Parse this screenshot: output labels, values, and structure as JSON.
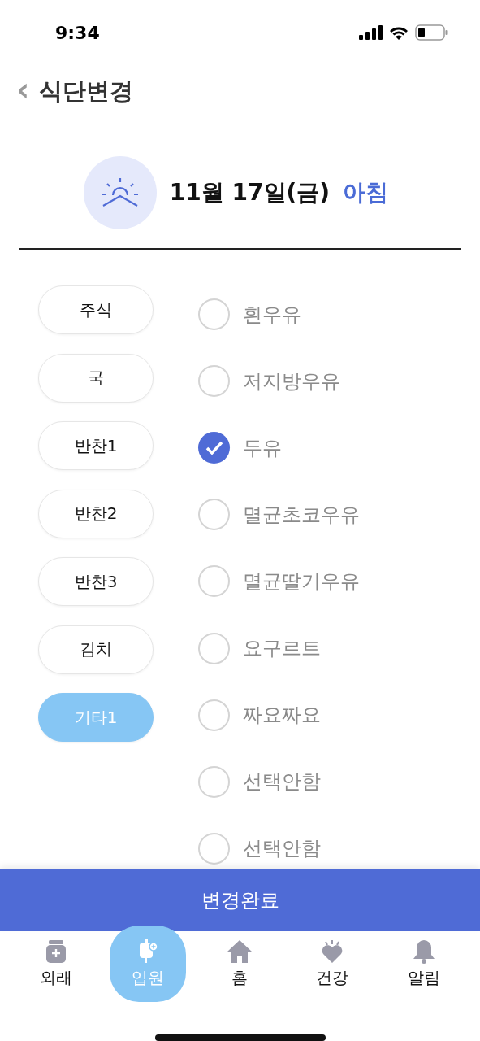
{
  "status_bar": {
    "time": "9:34"
  },
  "header": {
    "back": "‹",
    "title": "식단변경"
  },
  "meal": {
    "date": "11월 17일(금)",
    "period": "아침"
  },
  "categories": [
    {
      "label": "주식",
      "selected": false
    },
    {
      "label": "국",
      "selected": false
    },
    {
      "label": "반찬1",
      "selected": false
    },
    {
      "label": "반찬2",
      "selected": false
    },
    {
      "label": "반찬3",
      "selected": false
    },
    {
      "label": "김치",
      "selected": false
    },
    {
      "label": "기타1",
      "selected": true
    }
  ],
  "options": [
    {
      "label": "흰우유",
      "selected": false
    },
    {
      "label": "저지방우유",
      "selected": false
    },
    {
      "label": "두유",
      "selected": true
    },
    {
      "label": "멸균초코우유",
      "selected": false
    },
    {
      "label": "멸균딸기우유",
      "selected": false
    },
    {
      "label": "요구르트",
      "selected": false
    },
    {
      "label": "짜요짜요",
      "selected": false
    },
    {
      "label": "선택안함",
      "selected": false
    },
    {
      "label": "선택안함",
      "selected": false
    }
  ],
  "submit_button": "변경완료",
  "tabs": [
    {
      "label": "외래",
      "selected": false
    },
    {
      "label": "입원",
      "selected": true
    },
    {
      "label": "홈",
      "selected": false
    },
    {
      "label": "건강",
      "selected": false
    },
    {
      "label": "알림",
      "selected": false
    }
  ]
}
